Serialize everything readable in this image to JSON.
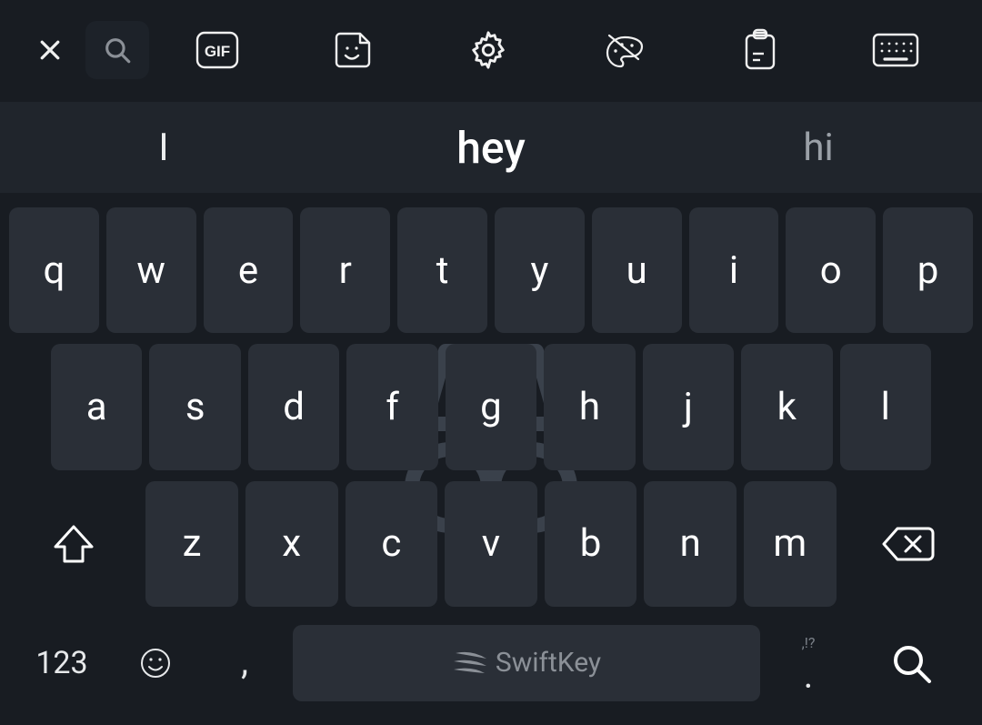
{
  "toolbar": {
    "close": "close",
    "search": "search",
    "gif_label": "GIF",
    "sticker": "sticker",
    "settings": "settings",
    "themes": "themes",
    "clipboard": "clipboard",
    "onehanded": "keyboard-modes"
  },
  "suggestions": {
    "left": "I",
    "center": "hey",
    "right": "hi"
  },
  "rows": {
    "r1": [
      "q",
      "w",
      "e",
      "r",
      "t",
      "y",
      "u",
      "i",
      "o",
      "p"
    ],
    "r2": [
      "a",
      "s",
      "d",
      "f",
      "g",
      "h",
      "j",
      "k",
      "l"
    ],
    "r3": [
      "z",
      "x",
      "c",
      "v",
      "b",
      "n",
      "m"
    ]
  },
  "bottom": {
    "numbers_label": "123",
    "comma": ",",
    "space_label": "SwiftKey",
    "period_hint": ",!?",
    "period": "."
  }
}
